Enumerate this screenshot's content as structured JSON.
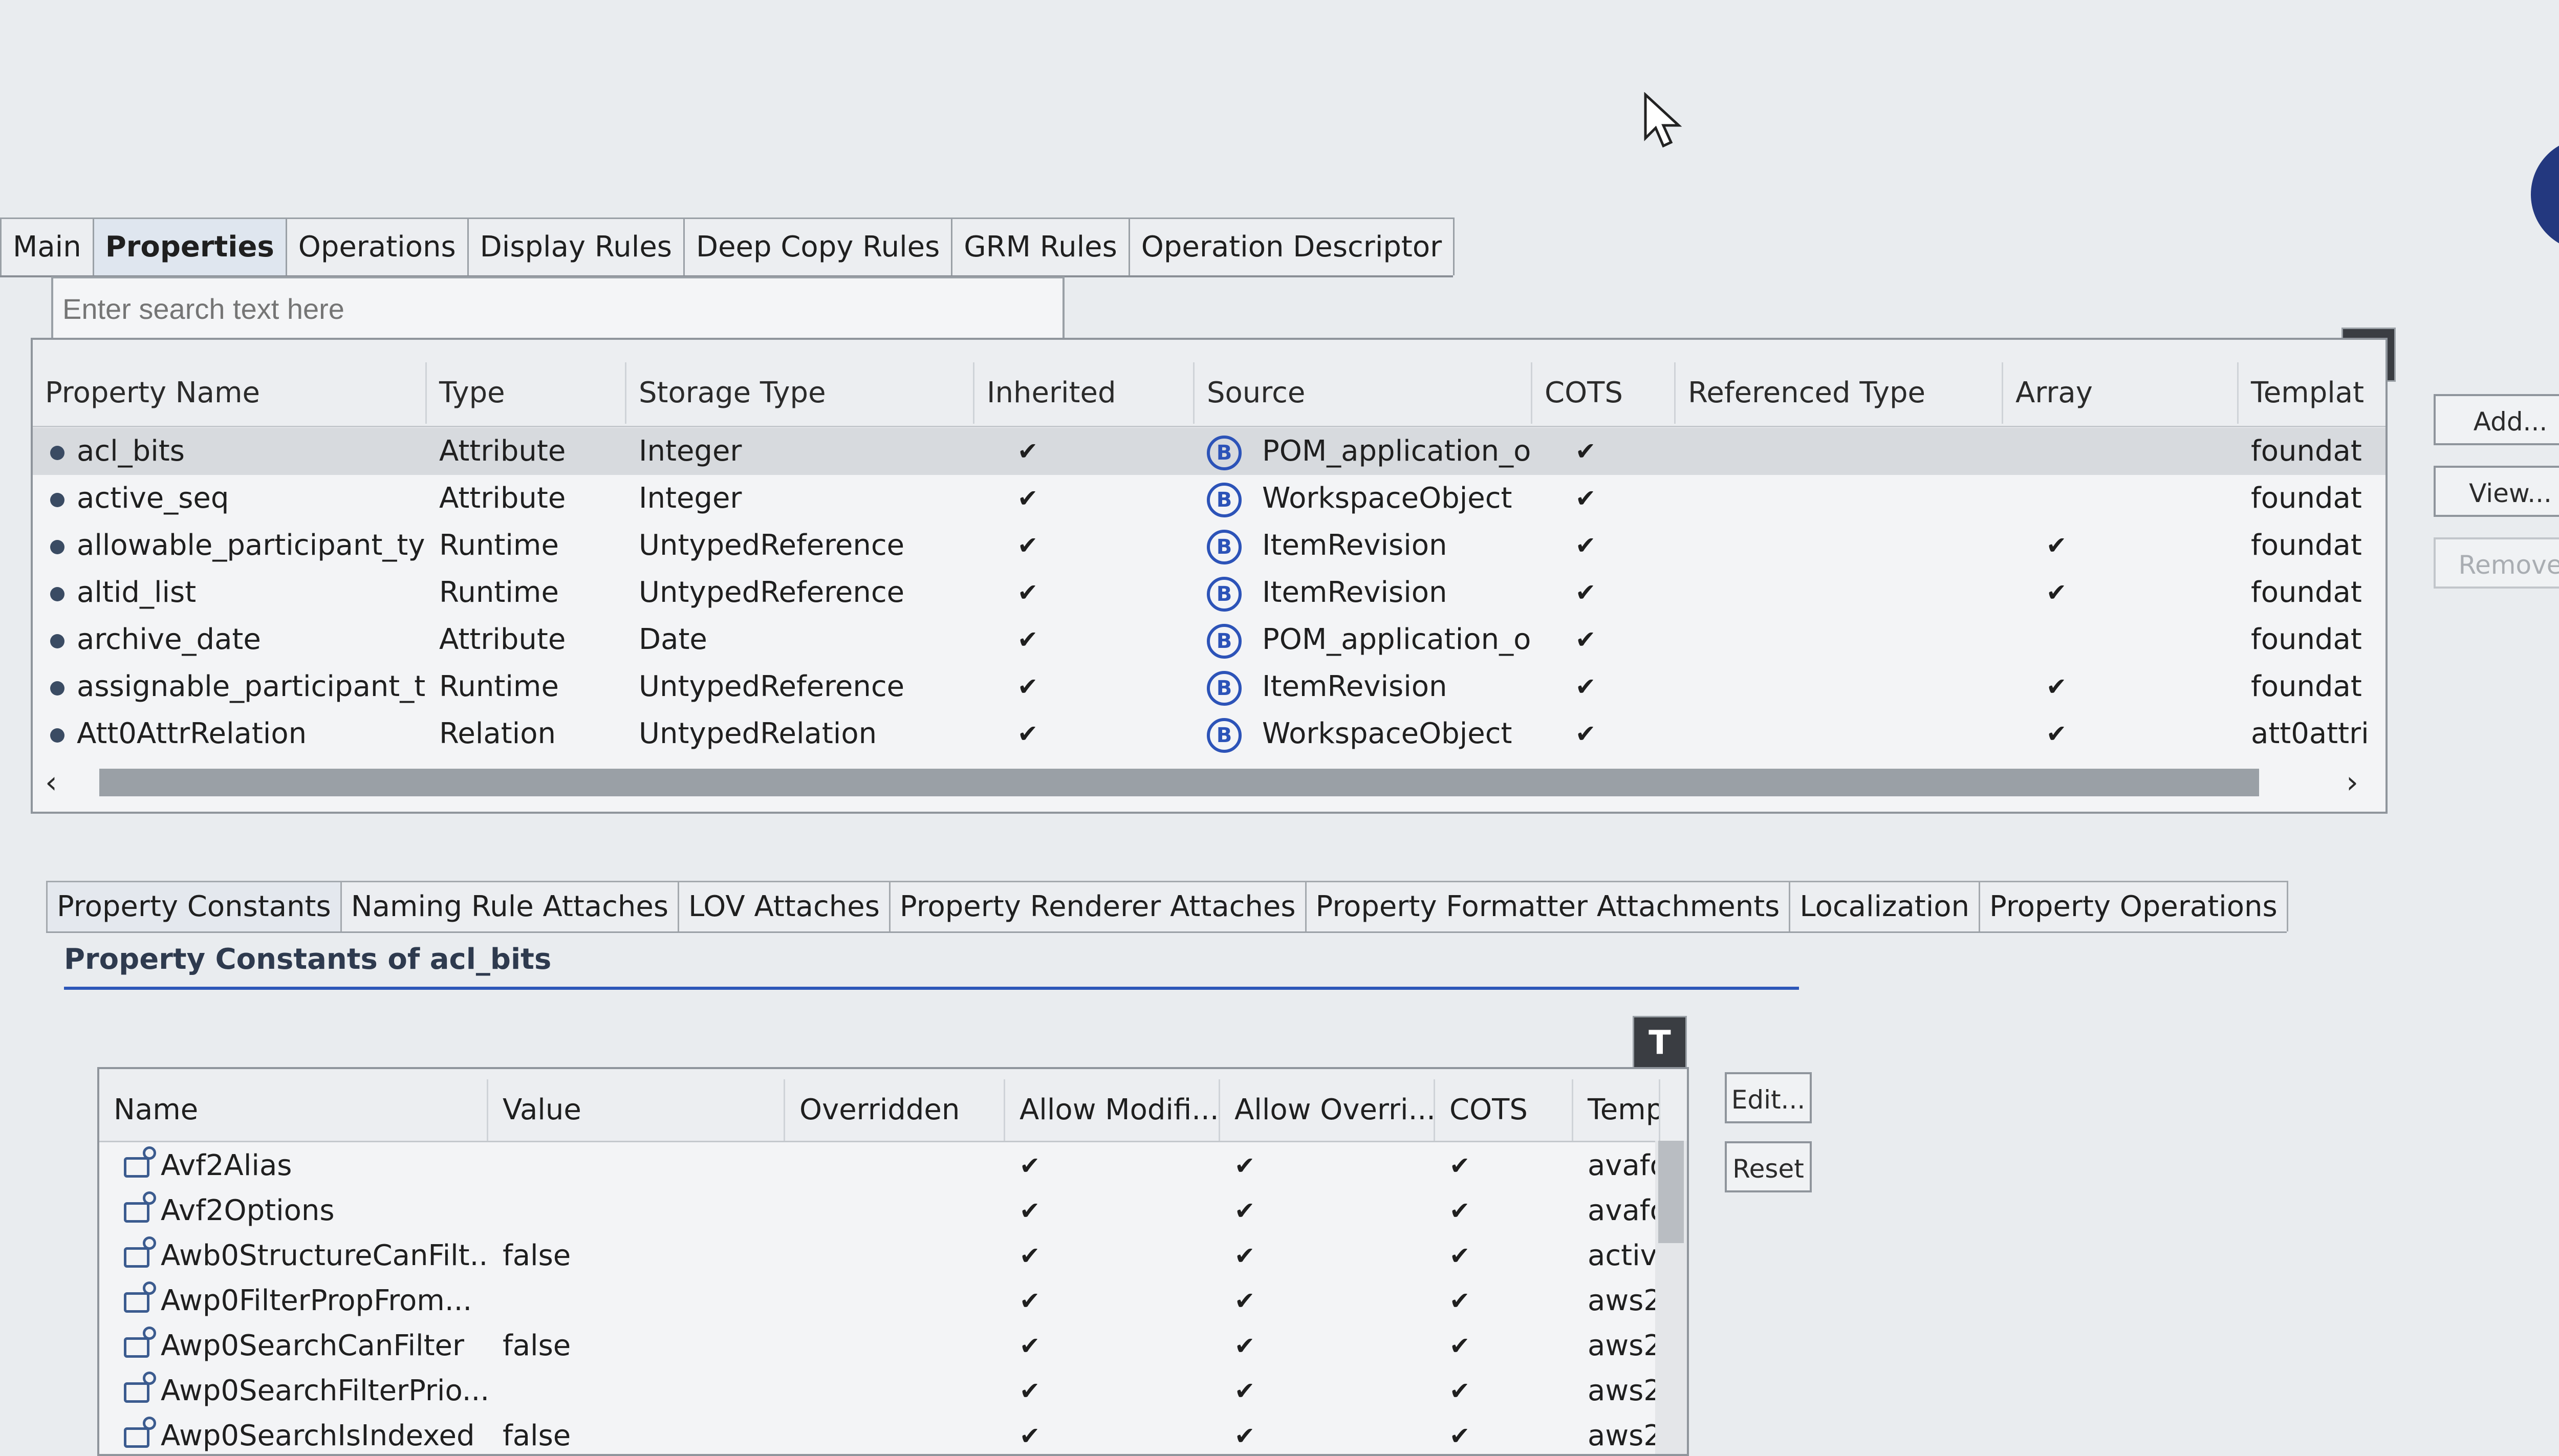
{
  "top_tabs": [
    "Main",
    "Properties",
    "Operations",
    "Display Rules",
    "Deep Copy Rules",
    "GRM Rules",
    "Operation Descriptor"
  ],
  "search": {
    "placeholder": "Enter search text here"
  },
  "properties_table": {
    "columns": [
      "Property Name",
      "Type",
      "Storage Type",
      "Inherited",
      "Source",
      "COTS",
      "Referenced Type",
      "Array",
      "Templat"
    ],
    "rows": [
      {
        "name": "acl_bits",
        "type": "Attribute",
        "storage": "Integer",
        "inherited": "✔",
        "source": "POM_application_ob",
        "cots": "✔",
        "ref": "",
        "array": "",
        "template": "foundat"
      },
      {
        "name": "active_seq",
        "type": "Attribute",
        "storage": "Integer",
        "inherited": "✔",
        "source": "WorkspaceObject",
        "cots": "✔",
        "ref": "",
        "array": "",
        "template": "foundat"
      },
      {
        "name": "allowable_participant_ty",
        "type": "Runtime",
        "storage": "UntypedReference",
        "inherited": "✔",
        "source": "ItemRevision",
        "cots": "✔",
        "ref": "",
        "array": "✔",
        "template": "foundat"
      },
      {
        "name": "altid_list",
        "type": "Runtime",
        "storage": "UntypedReference",
        "inherited": "✔",
        "source": "ItemRevision",
        "cots": "✔",
        "ref": "",
        "array": "✔",
        "template": "foundat"
      },
      {
        "name": "archive_date",
        "type": "Attribute",
        "storage": "Date",
        "inherited": "✔",
        "source": "POM_application_ob",
        "cots": "✔",
        "ref": "",
        "array": "",
        "template": "foundat"
      },
      {
        "name": "assignable_participant_t",
        "type": "Runtime",
        "storage": "UntypedReference",
        "inherited": "✔",
        "source": "ItemRevision",
        "cots": "✔",
        "ref": "",
        "array": "✔",
        "template": "foundat"
      },
      {
        "name": "Att0AttrRelation",
        "type": "Relation",
        "storage": "UntypedRelation",
        "inherited": "✔",
        "source": "WorkspaceObject",
        "cots": "✔",
        "ref": "",
        "array": "✔",
        "template": "att0attri"
      }
    ]
  },
  "side_buttons": {
    "add": "Add...",
    "view": "View...",
    "remove": "Remove"
  },
  "filter_glyph": "T",
  "bottom_tabs": [
    "Property Constants",
    "Naming Rule Attaches",
    "LOV Attaches",
    "Property Renderer Attaches",
    "Property Formatter Attachments",
    "Localization",
    "Property Operations"
  ],
  "section_title": "Property Constants of acl_bits",
  "constants_table": {
    "columns": [
      "Name",
      "Value",
      "Overridden",
      "Allow Modifi...",
      "Allow Overri...",
      "COTS",
      "Temp"
    ],
    "rows": [
      {
        "name": "Avf2Alias",
        "value": "",
        "overridden": "",
        "allow_mod": "✔",
        "allow_over": "✔",
        "cots": "✔",
        "temp": "avafo"
      },
      {
        "name": "Avf2Options",
        "value": "",
        "overridden": "",
        "allow_mod": "✔",
        "allow_over": "✔",
        "cots": "✔",
        "temp": "avafo"
      },
      {
        "name": "Awb0StructureCanFilt...",
        "value": "false",
        "overridden": "",
        "allow_mod": "✔",
        "allow_over": "✔",
        "cots": "✔",
        "temp": "active"
      },
      {
        "name": "Awp0FilterPropFrom...",
        "value": "",
        "overridden": "",
        "allow_mod": "✔",
        "allow_over": "✔",
        "cots": "✔",
        "temp": "aws2"
      },
      {
        "name": "Awp0SearchCanFilter",
        "value": "false",
        "overridden": "",
        "allow_mod": "✔",
        "allow_over": "✔",
        "cots": "✔",
        "temp": "aws2"
      },
      {
        "name": "Awp0SearchFilterPrio...",
        "value": "",
        "overridden": "",
        "allow_mod": "✔",
        "allow_over": "✔",
        "cots": "✔",
        "temp": "aws2"
      },
      {
        "name": "Awp0SearchIsIndexed",
        "value": "false",
        "overridden": "",
        "allow_mod": "✔",
        "allow_over": "✔",
        "cots": "✔",
        "temp": "aws2"
      }
    ]
  },
  "constants_buttons": {
    "edit": "Edit...",
    "reset": "Reset"
  },
  "avatar_letter": "B",
  "colors": {
    "accent": "#2d57b9",
    "selected_row": "#d7dade",
    "source_icon": "#2c53b8"
  }
}
